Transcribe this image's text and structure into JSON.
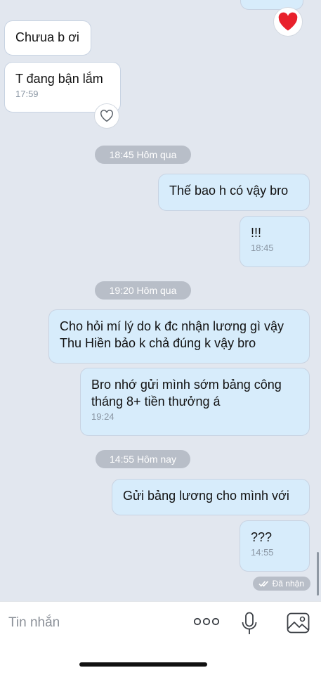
{
  "messages": {
    "m1": {
      "text": "Chưua b ơi"
    },
    "m2": {
      "text": "T đang bận lắm",
      "time": "17:59"
    },
    "m3": {
      "text": "Thế bao h có vậy bro"
    },
    "m4": {
      "text": "!!!",
      "time": "18:45"
    },
    "m5": {
      "text": "Cho hỏi mí lý do k đc nhận lương gì vậy Thu Hiền bảo k chả đúng k vậy bro"
    },
    "m6": {
      "text": "Bro nhớ gửi mình sớm bảng công tháng 8+ tiền thưởng á",
      "time": "19:24"
    },
    "m7": {
      "text": "Gửi bảng lương cho mình với"
    },
    "m8": {
      "text": "???",
      "time": "14:55"
    }
  },
  "separators": {
    "s1": "18:45 Hôm qua",
    "s2": "19:20 Hôm qua",
    "s3": "14:55 Hôm nay"
  },
  "status": {
    "received": "Đã nhận"
  },
  "composer": {
    "placeholder": "Tin nhắn"
  },
  "icons": {
    "reaction_top": "heart-filled-icon",
    "reaction_m2": "heart-outline-icon",
    "more": "more-dots-icon",
    "mic": "microphone-icon",
    "image": "image-icon",
    "check": "double-check-icon"
  },
  "colors": {
    "background": "#e2e7ef",
    "bubble_in": "#ffffff",
    "bubble_out": "#d7ecfb",
    "heart": "#e8212c"
  }
}
